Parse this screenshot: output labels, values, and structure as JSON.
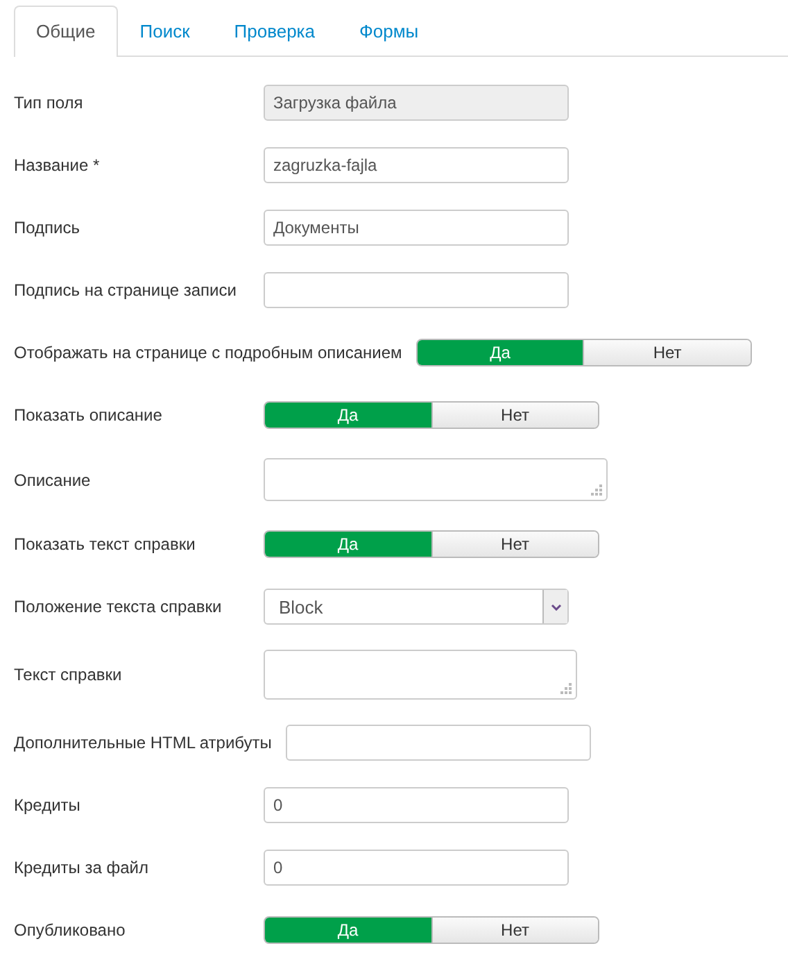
{
  "tabs": [
    {
      "label": "Общие",
      "selected": true
    },
    {
      "label": "Поиск",
      "selected": false
    },
    {
      "label": "Проверка",
      "selected": false
    },
    {
      "label": "Формы",
      "selected": false
    }
  ],
  "fields": [
    {
      "label": "Тип поля",
      "kind": "text",
      "value": "Загрузка файла",
      "disabled": true
    },
    {
      "label": "Название *",
      "kind": "text",
      "value": "zagruzka-fajla",
      "disabled": false
    },
    {
      "label": "Подпись",
      "kind": "text",
      "value": "Документы",
      "disabled": false
    },
    {
      "label": "Подпись на странице записи",
      "kind": "text",
      "disabled": false
    },
    {
      "label": "Отображать на странице с подробным описанием",
      "kind": "toggle",
      "options": [
        {
          "label": "Да",
          "selected": true
        },
        {
          "label": "Нет",
          "selected": false
        }
      ]
    },
    {
      "label": "Показать описание",
      "kind": "toggle",
      "options": [
        {
          "label": "Да",
          "selected": true
        },
        {
          "label": "Нет",
          "selected": false
        }
      ]
    },
    {
      "label": "Описание",
      "kind": "textarea"
    },
    {
      "label": "Показать текст справки",
      "kind": "toggle",
      "options": [
        {
          "label": "Да",
          "selected": true
        },
        {
          "label": "Нет",
          "selected": false
        }
      ]
    },
    {
      "label": "Положение текста справки",
      "kind": "select",
      "value": "Block"
    },
    {
      "label": "Текст справки",
      "kind": "textarea",
      "narrow": true
    },
    {
      "label": "Дополнительные HTML атрибуты",
      "kind": "text",
      "disabled": false
    },
    {
      "label": "Кредиты",
      "kind": "text",
      "value": "0",
      "disabled": false
    },
    {
      "label": "Кредиты за файл",
      "kind": "text",
      "value": "0",
      "disabled": false
    },
    {
      "label": "Опубликовано",
      "kind": "toggle",
      "options": [
        {
          "label": "Да",
          "selected": true
        },
        {
          "label": "Нет",
          "selected": false
        }
      ]
    }
  ]
}
